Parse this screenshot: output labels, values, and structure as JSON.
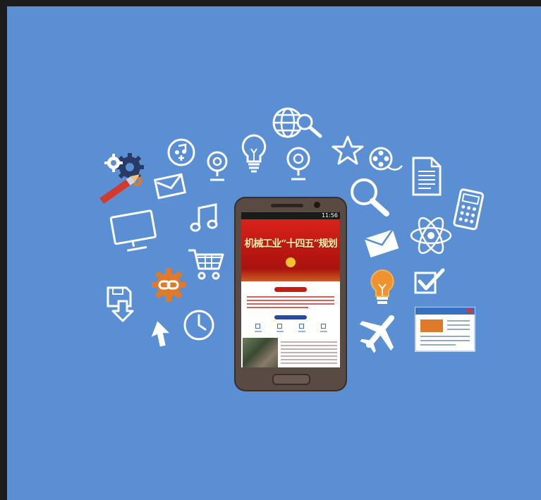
{
  "phone": {
    "status_time": "11:56",
    "screen": {
      "hero_topline": "",
      "headline": "机械工业“十四五”规划"
    }
  },
  "icons": [
    "paint-gears-icon",
    "email-icon",
    "music-add-icon",
    "webcam-icon",
    "lightbulb-icon",
    "webcam-icon",
    "globe-search-icon",
    "star-icon",
    "film-reel-icon",
    "document-icon",
    "monitor-icon",
    "music-note-icon",
    "magnifier-icon",
    "calculator-icon",
    "shopping-cart-icon",
    "envelope-icon",
    "atom-icon",
    "link-gear-icon",
    "floppy-save-icon",
    "lightbulb-glow-icon",
    "checkbox-icon",
    "cursor-arrow-icon",
    "clock-icon",
    "airplane-icon",
    "browser-window-icon"
  ],
  "colors": {
    "background": "#5b8fd3",
    "icon_line": "#ffffff",
    "accent_orange": "#e07a2b",
    "accent_red": "#d23a2e",
    "gear_navy": "#2a3a66"
  }
}
